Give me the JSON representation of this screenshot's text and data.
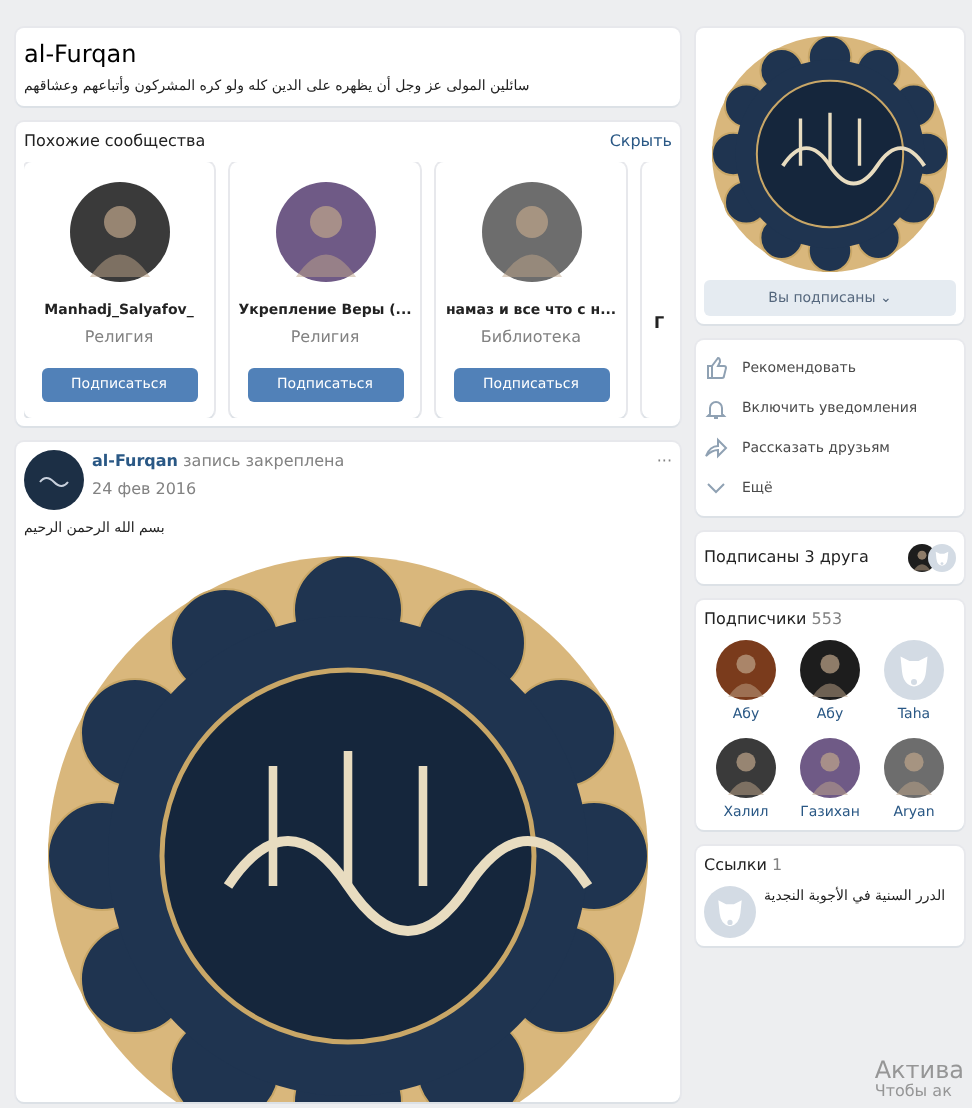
{
  "header": {
    "title": "al-Furqan",
    "status": "سائلين المولى عز وجل أن يظهره على الدين كله ولو كره المشركون وأتباعهم وعشاقهم"
  },
  "similar": {
    "title": "Похожие сообщества",
    "hide": "Скрыть",
    "items": [
      {
        "name": "Manhadj_Salyafov_",
        "category": "Религия",
        "button": "Подписаться",
        "kind": "full"
      },
      {
        "name": "Укрепление Веры (...",
        "category": "Религия",
        "button": "Подписаться",
        "kind": "full"
      },
      {
        "name": "намаз и все что с н...",
        "category": "Библиотека",
        "button": "Подписаться",
        "kind": "full"
      },
      {
        "name": "Г",
        "kind": "partial"
      }
    ]
  },
  "post": {
    "author": "al-Furqan",
    "note": "запись закреплена",
    "date": "24 фев 2016",
    "menu": "···",
    "text": "بسم الله الرحمن الرحيم"
  },
  "subscribe_button": {
    "label": "Вы подписаны",
    "caret": "⌄"
  },
  "actions": [
    {
      "kind": "recommend",
      "label": "Рекомендовать"
    },
    {
      "kind": "bell",
      "label": "Включить уведомления"
    },
    {
      "kind": "share",
      "label": "Рассказать друзьям"
    },
    {
      "kind": "more",
      "label": "Ещё"
    }
  ],
  "friends": {
    "label": "Подписаны 3 друга"
  },
  "followers": {
    "title": "Подписчики",
    "count": "553",
    "items": [
      {
        "name": "Абу",
        "kind": "photo"
      },
      {
        "name": "Абу",
        "kind": "photo"
      },
      {
        "name": "Taha",
        "kind": "default"
      },
      {
        "name": "Халил",
        "kind": "photo"
      },
      {
        "name": "Газихан",
        "kind": "photo"
      },
      {
        "name": "Aryan",
        "kind": "photo"
      }
    ]
  },
  "links": {
    "title": "Ссылки",
    "count": "1",
    "items": [
      {
        "text": "الدرر السنية في الأجوبة النجدية"
      }
    ]
  },
  "activation": {
    "title": "Актива",
    "line": "Чтобы ак"
  }
}
